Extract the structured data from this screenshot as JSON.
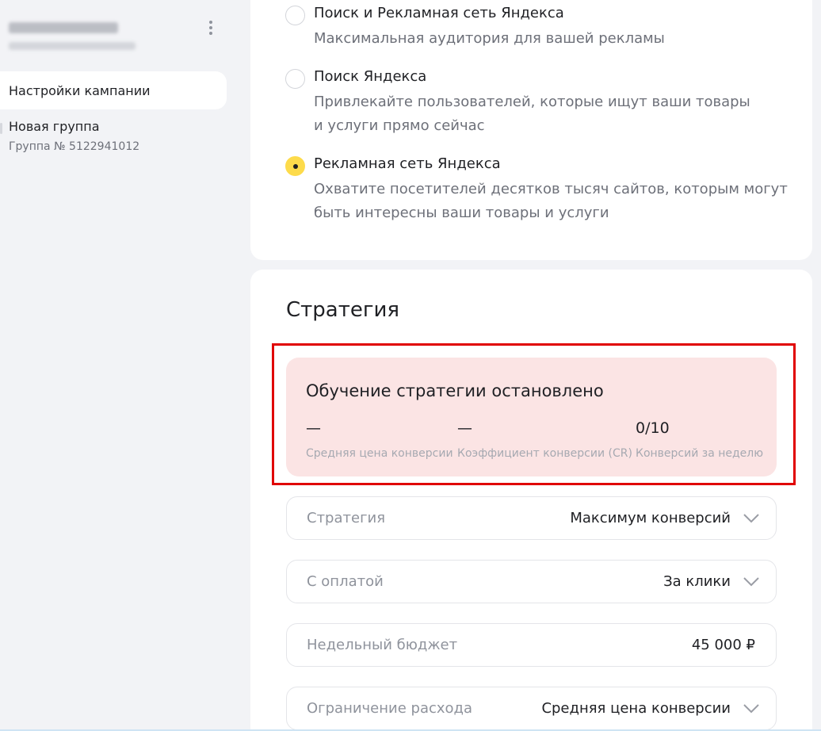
{
  "sidebar": {
    "nav_active": "Настройки кампании",
    "group": {
      "title": "Новая группа",
      "subtitle": "Группа № 5122941012"
    }
  },
  "placement": {
    "options": [
      {
        "title": "Поиск и Рекламная сеть Яндекса",
        "description": [
          "Максимальная аудитория для вашей рекламы"
        ],
        "checked": false
      },
      {
        "title": "Поиск Яндекса",
        "description": [
          "Привлекайте пользователей, которые ищут ваши товары",
          "и услуги прямо сейчас"
        ],
        "checked": false
      },
      {
        "title": "Рекламная сеть Яндекса",
        "description": [
          "Охватите посетителей десятков тысяч сайтов, которым могут",
          "быть интересны ваши товары и услуги"
        ],
        "checked": true
      }
    ]
  },
  "strategy": {
    "heading": "Стратегия",
    "status": {
      "title": "Обучение стратегии остановлено",
      "metrics": [
        {
          "value": "—",
          "label": "Средняя цена конверсии"
        },
        {
          "value": "—",
          "label": "Коэффициент конверсии (CR)"
        },
        {
          "value": "0/10",
          "label": "Конверсий за неделю"
        }
      ]
    },
    "fields": [
      {
        "label": "Стратегия",
        "value": "Максимум конверсий",
        "icon": "chevron-down-icon"
      },
      {
        "label": "С оплатой",
        "value": "За клики",
        "icon": "chevron-down-icon"
      },
      {
        "label": "Недельный бюджет",
        "value": "45 000  ₽"
      },
      {
        "label": "Ограничение расхода",
        "value": "Средняя цена конверсии",
        "icon": "chevron-down-icon"
      }
    ]
  },
  "colors": {
    "accent_radio": "#fddb4b",
    "alert_bg": "#fbe4e4",
    "highlight_frame": "#e00000",
    "page_bg": "#f2f3f6"
  }
}
